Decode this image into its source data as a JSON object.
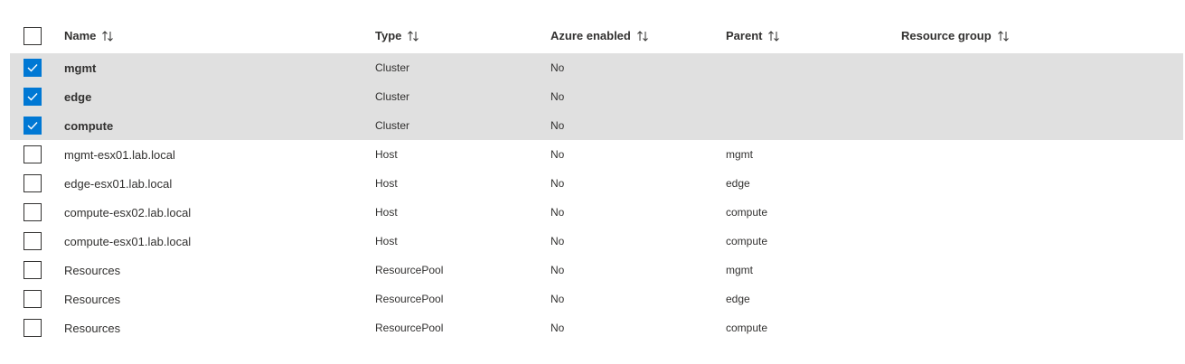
{
  "columns": {
    "name": "Name",
    "type": "Type",
    "azure_enabled": "Azure enabled",
    "parent": "Parent",
    "resource_group": "Resource group"
  },
  "rows": [
    {
      "name": "mgmt",
      "type": "Cluster",
      "azure": "No",
      "parent": "",
      "rg": "",
      "selected": true
    },
    {
      "name": "edge",
      "type": "Cluster",
      "azure": "No",
      "parent": "",
      "rg": "",
      "selected": true
    },
    {
      "name": "compute",
      "type": "Cluster",
      "azure": "No",
      "parent": "",
      "rg": "",
      "selected": true
    },
    {
      "name": "mgmt-esx01.lab.local",
      "type": "Host",
      "azure": "No",
      "parent": "mgmt",
      "rg": "",
      "selected": false
    },
    {
      "name": "edge-esx01.lab.local",
      "type": "Host",
      "azure": "No",
      "parent": "edge",
      "rg": "",
      "selected": false
    },
    {
      "name": "compute-esx02.lab.local",
      "type": "Host",
      "azure": "No",
      "parent": "compute",
      "rg": "",
      "selected": false
    },
    {
      "name": "compute-esx01.lab.local",
      "type": "Host",
      "azure": "No",
      "parent": "compute",
      "rg": "",
      "selected": false
    },
    {
      "name": "Resources",
      "type": "ResourcePool",
      "azure": "No",
      "parent": "mgmt",
      "rg": "",
      "selected": false
    },
    {
      "name": "Resources",
      "type": "ResourcePool",
      "azure": "No",
      "parent": "edge",
      "rg": "",
      "selected": false
    },
    {
      "name": "Resources",
      "type": "ResourcePool",
      "azure": "No",
      "parent": "compute",
      "rg": "",
      "selected": false
    }
  ],
  "icons": {
    "sort": "sort-icon",
    "check": "checkmark-icon"
  },
  "colors": {
    "checkbox_checked": "#0078d4",
    "selected_row": "#e0e0e0",
    "text": "#323130"
  }
}
